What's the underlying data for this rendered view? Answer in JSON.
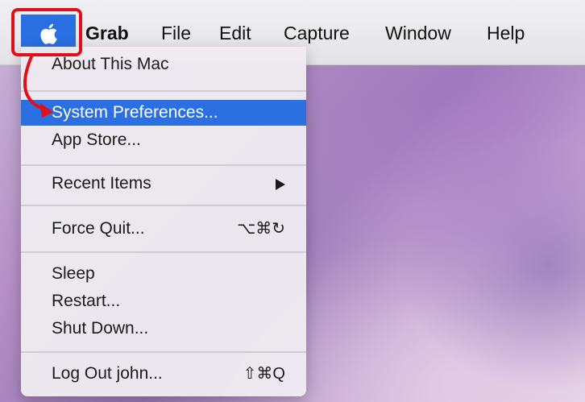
{
  "menubar": {
    "app_name": "Grab",
    "items": [
      {
        "label": "File"
      },
      {
        "label": "Edit"
      },
      {
        "label": "Capture"
      },
      {
        "label": "Window"
      },
      {
        "label": "Help"
      }
    ]
  },
  "apple_menu": {
    "items": [
      {
        "label": "About This Mac"
      },
      {
        "label": "System Preferences...",
        "selected": true
      },
      {
        "label": "App Store..."
      },
      {
        "label": "Recent Items",
        "has_submenu": true
      },
      {
        "label": "Force Quit...",
        "shortcut": "⌥⌘↻"
      },
      {
        "label": "Sleep"
      },
      {
        "label": "Restart..."
      },
      {
        "label": "Shut Down..."
      },
      {
        "label": "Log Out john...",
        "shortcut": "⇧⌘Q"
      }
    ]
  },
  "colors": {
    "selection": "#2c6fe0",
    "annotation": "#e0101b"
  },
  "icons": {
    "apple": "apple-logo-icon",
    "submenu": "triangle-right-icon",
    "annotation_arrow": "curved-arrow-icon"
  }
}
